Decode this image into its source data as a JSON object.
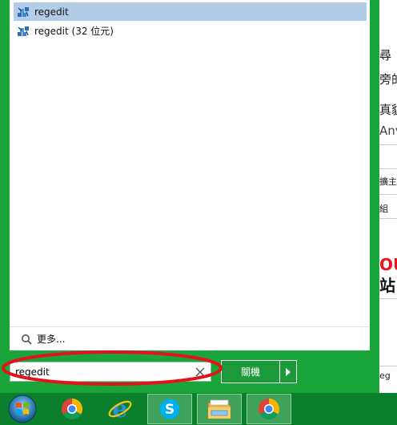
{
  "background_page": {
    "fragments": [
      "尋",
      "旁的",
      "真貌",
      "Anv",
      "擴主",
      "組",
      "OU",
      "站",
      "eg"
    ]
  },
  "start_menu": {
    "results": [
      {
        "label": "regedit",
        "icon": "regedit-icon",
        "selected": true
      },
      {
        "label": "regedit (32 位元)",
        "icon": "regedit-icon",
        "selected": false
      }
    ],
    "more_label": "更多...",
    "search": {
      "value": "regedit"
    },
    "shutdown_label": "關機"
  },
  "taskbar": {
    "items": [
      {
        "icon": "windows-start-icon"
      },
      {
        "icon": "chrome-icon"
      },
      {
        "icon": "internet-explorer-icon"
      },
      {
        "icon": "skype-icon"
      },
      {
        "icon": "file-explorer-icon"
      },
      {
        "icon": "chrome-icon"
      }
    ]
  },
  "colors": {
    "menu_green": "#1aa53b",
    "taskbar_green": "#0b7f2c",
    "selection": "#b3cde9",
    "annotation_red": "#e3131b"
  }
}
